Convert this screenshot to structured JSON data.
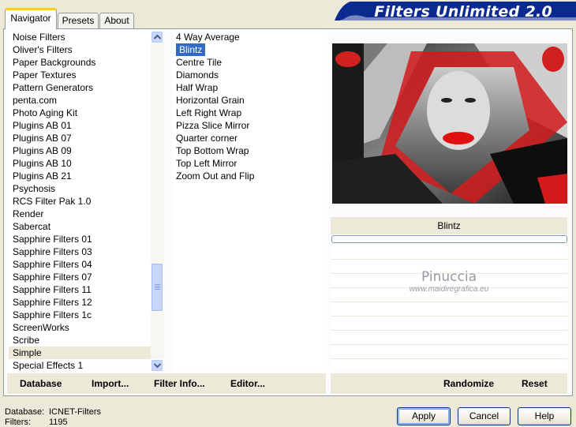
{
  "tabs": [
    {
      "label": "Navigator"
    },
    {
      "label": "Presets"
    },
    {
      "label": "About"
    }
  ],
  "app_title": "Filters Unlimited 2.0",
  "categories": [
    "Noise Filters",
    "Oliver's Filters",
    "Paper Backgrounds",
    "Paper Textures",
    "Pattern Generators",
    "penta.com",
    "Photo Aging Kit",
    "Plugins AB 01",
    "Plugins AB 07",
    "Plugins AB 09",
    "Plugins AB 10",
    "Plugins AB 21",
    "Psychosis",
    "RCS Filter Pak 1.0",
    "Render",
    "Sabercat",
    "Sapphire Filters 01",
    "Sapphire Filters 03",
    "Sapphire Filters 04",
    "Sapphire Filters 07",
    "Sapphire Filters 11",
    "Sapphire Filters 12",
    "Sapphire Filters 1c",
    "ScreenWorks",
    "Scribe",
    "Simple",
    "Special Effects 1"
  ],
  "selected_category": "Simple",
  "filters": [
    "4 Way Average",
    "Blintz",
    "Centre Tile",
    "Diamonds",
    "Half Wrap",
    "Horizontal Grain",
    "Left Right Wrap",
    "Pizza Slice Mirror",
    "Quarter corner",
    "Top Bottom Wrap",
    "Top Left Mirror",
    "Zoom Out and Flip"
  ],
  "selected_filter": "Blintz",
  "preview_label": "Blintz",
  "watermark": {
    "name": "Pinuccia",
    "url": "www.maidiregrafica.eu"
  },
  "bottom_left_buttons": {
    "database": "Database",
    "import": "Import...",
    "filter_info": "Filter Info...",
    "editor": "Editor..."
  },
  "bottom_right_buttons": {
    "randomize": "Randomize",
    "reset": "Reset"
  },
  "status": {
    "database_label": "Database:",
    "database_value": "ICNET-Filters",
    "filters_label": "Filters:",
    "filters_value": "1195"
  },
  "dialog_buttons": {
    "apply": "Apply",
    "cancel": "Cancel",
    "help": "Help"
  },
  "colors": {
    "banner": "#0b2a8f",
    "selection": "#316ac5",
    "accent_red": "#d21a1a"
  }
}
